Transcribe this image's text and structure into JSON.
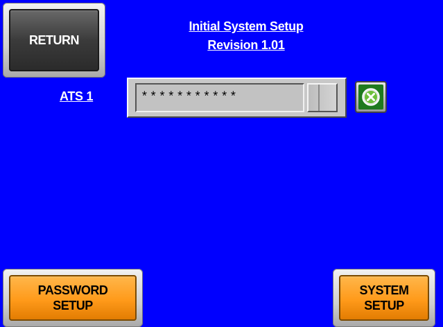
{
  "header": {
    "title_line1": "Initial System Setup",
    "title_line2": "Revision 1.01"
  },
  "buttons": {
    "return_label": "RETURN",
    "password_setup_line1": "PASSWORD",
    "password_setup_line2": "SETUP",
    "system_setup_line1": "SYSTEM",
    "system_setup_line2": "SETUP"
  },
  "ats": {
    "label": "ATS 1",
    "password_value": "***********"
  },
  "colors": {
    "background": "#0000ff",
    "return_button": "#3b3b3b",
    "setup_buttons": "#ff9a1a",
    "clear_button": "#1f7a1f"
  },
  "icons": {
    "clear": "close-circle-icon"
  }
}
